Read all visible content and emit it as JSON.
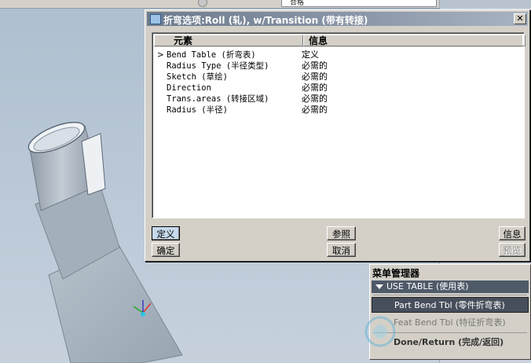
{
  "background": {
    "field_text": "合格"
  },
  "dialog": {
    "title": "折弯选项:Roll (轧), w/Transition (带有转接)",
    "close_glyph": "✕",
    "columns": [
      "元素",
      "信息"
    ],
    "rows": [
      {
        "element": "Bend Table (折弯表)",
        "info": "定义",
        "current": true
      },
      {
        "element": "Radius Type (半径类型)",
        "info": "必需的",
        "current": false
      },
      {
        "element": "Sketch (草绘)",
        "info": "必需的",
        "current": false
      },
      {
        "element": "Direction",
        "info": "必需的",
        "current": false
      },
      {
        "element": "Trans.areas (转接区域)",
        "info": "必需的",
        "current": false
      },
      {
        "element": "Radius (半径)",
        "info": "必需的",
        "current": false
      }
    ],
    "current_marker": ">",
    "buttons": {
      "define": "定义",
      "reference": "参照",
      "info": "信息",
      "ok": "确定",
      "cancel": "取消",
      "preview": "预览"
    }
  },
  "menu_manager": {
    "title": "菜单管理器",
    "section": "USE TABLE (使用表)",
    "items": [
      {
        "label": "Part Bend Tbl (零件折弯表)",
        "state": "selected"
      },
      {
        "label": "Feat Bend Tbl (特征折弯表)",
        "state": "enabled"
      },
      {
        "label": "Done/Return (完成/返回)",
        "state": "bold"
      }
    ]
  },
  "colors": {
    "viewport_bg": "#b9c7d6",
    "titlebar": "#6d7b8e",
    "model_surface": "#a9b6c2",
    "menu_selected": "#474f5c"
  }
}
